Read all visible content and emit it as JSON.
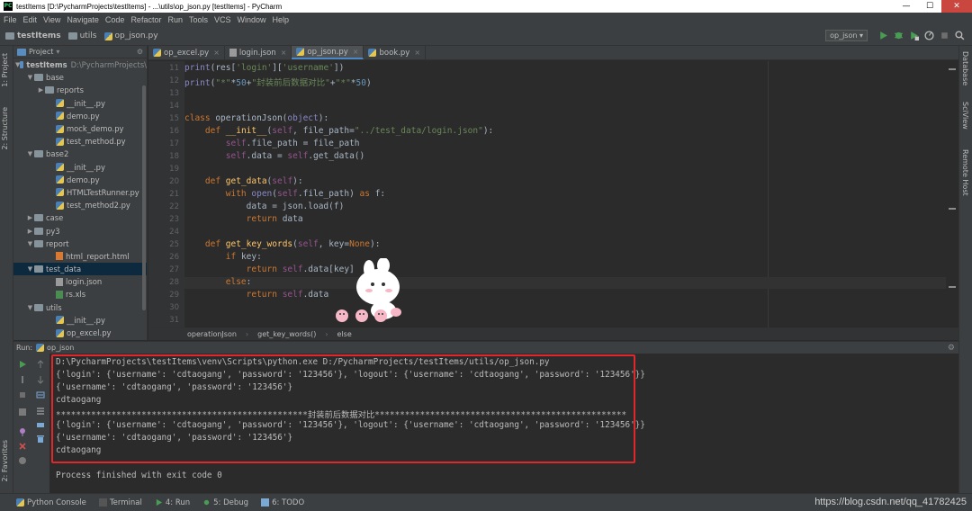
{
  "window": {
    "title": "testItems [D:\\PycharmProjects\\testItems] - ...\\utils\\op_json.py [testItems] - PyCharm",
    "icon_label": "PC"
  },
  "menu": [
    "File",
    "Edit",
    "View",
    "Navigate",
    "Code",
    "Refactor",
    "Run",
    "Tools",
    "VCS",
    "Window",
    "Help"
  ],
  "navbar": {
    "crumbs": [
      "testItems",
      "utils",
      "op_json.py"
    ],
    "run_config": "op_json"
  },
  "left_stripe": {
    "project": "1: Project",
    "structure": "2: Structure",
    "favorites": "2: Favorites"
  },
  "right_stripe": {
    "database": "Database",
    "sciview": "SciView",
    "remote_host": "Remote Host"
  },
  "project_panel": {
    "header": "Project",
    "root_name": "testItems",
    "root_path": "D:\\PycharmProjects\\",
    "items": [
      {
        "label": "base",
        "type": "folder",
        "indent": 1,
        "arrow": "open"
      },
      {
        "label": "reports",
        "type": "folder",
        "indent": 2,
        "arrow": "closed"
      },
      {
        "label": "__init__.py",
        "type": "py",
        "indent": 3,
        "arrow": ""
      },
      {
        "label": "demo.py",
        "type": "py",
        "indent": 3,
        "arrow": ""
      },
      {
        "label": "mock_demo.py",
        "type": "py",
        "indent": 3,
        "arrow": ""
      },
      {
        "label": "test_method.py",
        "type": "py",
        "indent": 3,
        "arrow": ""
      },
      {
        "label": "base2",
        "type": "folder",
        "indent": 1,
        "arrow": "open"
      },
      {
        "label": "__init__.py",
        "type": "py",
        "indent": 3,
        "arrow": ""
      },
      {
        "label": "demo.py",
        "type": "py",
        "indent": 3,
        "arrow": ""
      },
      {
        "label": "HTMLTestRunner.py",
        "type": "py",
        "indent": 3,
        "arrow": ""
      },
      {
        "label": "test_method2.py",
        "type": "py",
        "indent": 3,
        "arrow": ""
      },
      {
        "label": "case",
        "type": "folder",
        "indent": 1,
        "arrow": "closed"
      },
      {
        "label": "py3",
        "type": "folder",
        "indent": 1,
        "arrow": "closed"
      },
      {
        "label": "report",
        "type": "folder",
        "indent": 1,
        "arrow": "open"
      },
      {
        "label": "html_report.html",
        "type": "html",
        "indent": 3,
        "arrow": ""
      },
      {
        "label": "test_data",
        "type": "folder",
        "indent": 1,
        "arrow": "open",
        "selected": true
      },
      {
        "label": "login.json",
        "type": "json",
        "indent": 3,
        "arrow": ""
      },
      {
        "label": "rs.xls",
        "type": "xls",
        "indent": 3,
        "arrow": ""
      },
      {
        "label": "utils",
        "type": "folder",
        "indent": 1,
        "arrow": "open"
      },
      {
        "label": "__init__.py",
        "type": "py",
        "indent": 3,
        "arrow": ""
      },
      {
        "label": "op_excel.py",
        "type": "py",
        "indent": 3,
        "arrow": ""
      }
    ]
  },
  "editor": {
    "tabs": [
      {
        "label": "op_excel.py",
        "icon": "py",
        "active": false
      },
      {
        "label": "login.json",
        "icon": "json",
        "active": false
      },
      {
        "label": "op_json.py",
        "icon": "py",
        "active": true
      },
      {
        "label": "book.py",
        "icon": "py",
        "active": false
      }
    ],
    "line_numbers": [
      "11",
      "12",
      "13",
      "14",
      "15",
      "16",
      "17",
      "18",
      "19",
      "20",
      "21",
      "22",
      "23",
      "24",
      "25",
      "26",
      "27",
      "28",
      "29",
      "30",
      "31"
    ],
    "breadcrumbs": [
      "operationJson",
      "get_key_words()",
      "else"
    ]
  },
  "run_panel": {
    "header_label": "Run:",
    "header_config": "op_json",
    "output": [
      "D:\\PycharmProjects\\testItems\\venv\\Scripts\\python.exe D:/PycharmProjects/testItems/utils/op_json.py",
      "{'login': {'username': 'cdtaogang', 'password': '123456'}, 'logout': {'username': 'cdtaogang', 'password': '123456'}}",
      "{'username': 'cdtaogang', 'password': '123456'}",
      "cdtaogang",
      "**************************************************封装前后数据对比**************************************************",
      "{'login': {'username': 'cdtaogang', 'password': '123456'}, 'logout': {'username': 'cdtaogang', 'password': '123456'}}",
      "{'username': 'cdtaogang', 'password': '123456'}",
      "cdtaogang",
      "",
      "Process finished with exit code 0"
    ]
  },
  "statusbar": {
    "items": [
      "Python Console",
      "Terminal",
      "4: Run",
      "5: Debug",
      "6: TODO"
    ],
    "watermark": "https://blog.csdn.net/qq_41782425"
  },
  "colors": {
    "accent": "#4a88c7",
    "highlight_box": "#e0272b",
    "run_green": "#499c54"
  }
}
